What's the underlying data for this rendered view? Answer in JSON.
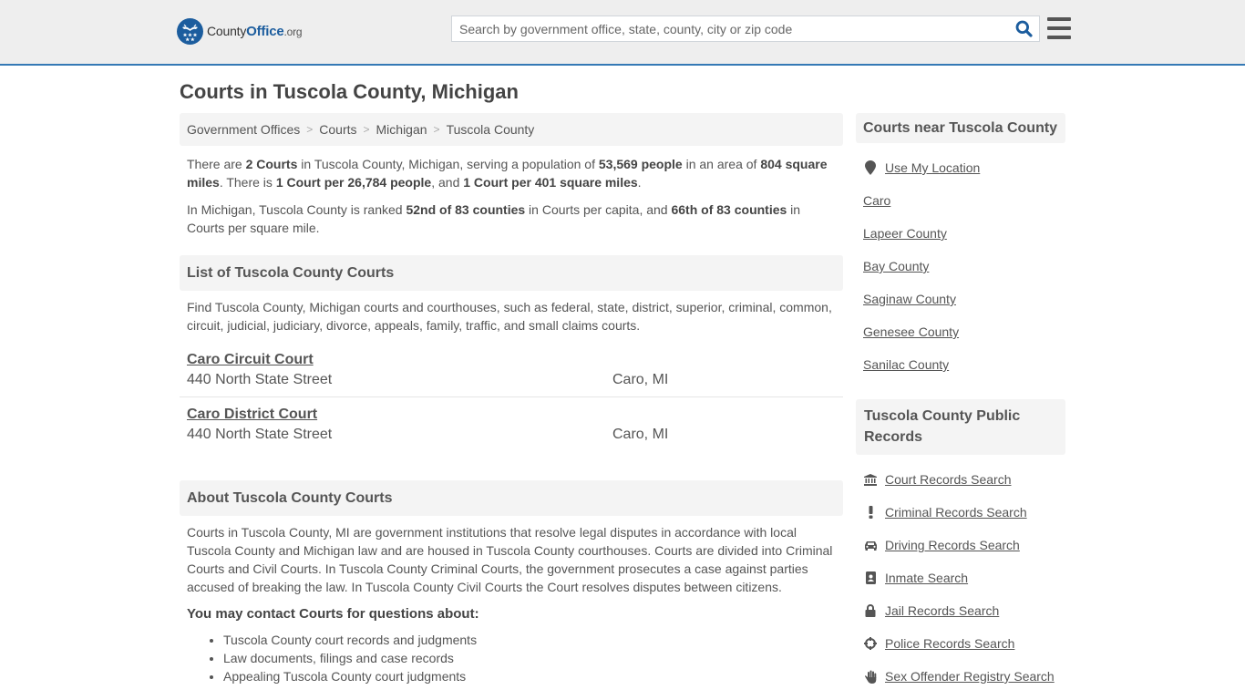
{
  "header": {
    "logo": {
      "county": "County",
      "office": "Office",
      "org": ".org"
    },
    "search": {
      "placeholder": "Search by government office, state, county, city or zip code",
      "value": ""
    },
    "icons": {
      "search": "search-icon",
      "menu": "hamburger-menu-icon"
    }
  },
  "page": {
    "title": "Courts in Tuscola County, Michigan"
  },
  "breadcrumb": [
    {
      "label": "Government Offices"
    },
    {
      "label": "Courts"
    },
    {
      "label": "Michigan"
    },
    {
      "label": "Tuscola County"
    }
  ],
  "summary": {
    "p1": {
      "t1": "There are ",
      "b1": "2 Courts",
      "t2": " in Tuscola County, Michigan, serving a population of ",
      "b2": "53,569 people",
      "t3": " in an area of ",
      "b3": "804 square miles",
      "t4": ". There is ",
      "b4": "1 Court per 26,784 people",
      "t5": ", and ",
      "b5": "1 Court per 401 square miles",
      "t6": "."
    },
    "p2": {
      "t1": "In Michigan, Tuscola County is ranked ",
      "b1": "52nd of 83 counties",
      "t2": " in Courts per capita, and ",
      "b2": "66th of 83 counties",
      "t3": " in Courts per square mile."
    }
  },
  "list_section": {
    "heading": "List of Tuscola County Courts",
    "description": "Find Tuscola County, Michigan courts and courthouses, such as federal, state, district, superior, criminal, common, circuit, judicial, judiciary, divorce, appeals, family, traffic, and small claims courts.",
    "courts": [
      {
        "name": "Caro Circuit Court",
        "address": "440 North State Street",
        "city": "Caro, MI"
      },
      {
        "name": "Caro District Court",
        "address": "440 North State Street",
        "city": "Caro, MI"
      }
    ]
  },
  "about_section": {
    "heading": "About Tuscola County Courts",
    "body": "Courts in Tuscola County, MI are government institutions that resolve legal disputes in accordance with local Tuscola County and Michigan law and are housed in Tuscola County courthouses. Courts are divided into Criminal Courts and Civil Courts. In Tuscola County Criminal Courts, the government prosecutes a case against parties accused of breaking the law. In Tuscola County Civil Courts the Court resolves disputes between citizens.",
    "contact_heading": "You may contact Courts for questions about:",
    "topics": [
      "Tuscola County court records and judgments",
      "Law documents, filings and case records",
      "Appealing Tuscola County court judgments"
    ]
  },
  "sidebar": {
    "nearby": {
      "heading": "Courts near Tuscola County",
      "use_location": {
        "label": "Use My Location",
        "icon": "map-marker-icon"
      },
      "links": [
        "Caro",
        "Lapeer County",
        "Bay County",
        "Saginaw County",
        "Genesee County",
        "Sanilac County"
      ]
    },
    "records": {
      "heading": "Tuscola County Public Records",
      "links": [
        {
          "label": "Court Records Search",
          "icon": "courthouse-icon"
        },
        {
          "label": "Criminal Records Search",
          "icon": "exclamation-icon"
        },
        {
          "label": "Driving Records Search",
          "icon": "car-icon"
        },
        {
          "label": "Inmate Search",
          "icon": "id-badge-icon"
        },
        {
          "label": "Jail Records Search",
          "icon": "lock-icon"
        },
        {
          "label": "Police Records Search",
          "icon": "crosshairs-icon"
        },
        {
          "label": "Sex Offender Registry Search",
          "icon": "hand-icon"
        }
      ]
    }
  },
  "colors": {
    "brand": "#1c5d9e",
    "header_border": "#3579b5",
    "text": "#555555",
    "panel_bg": "#f4f4f4"
  }
}
